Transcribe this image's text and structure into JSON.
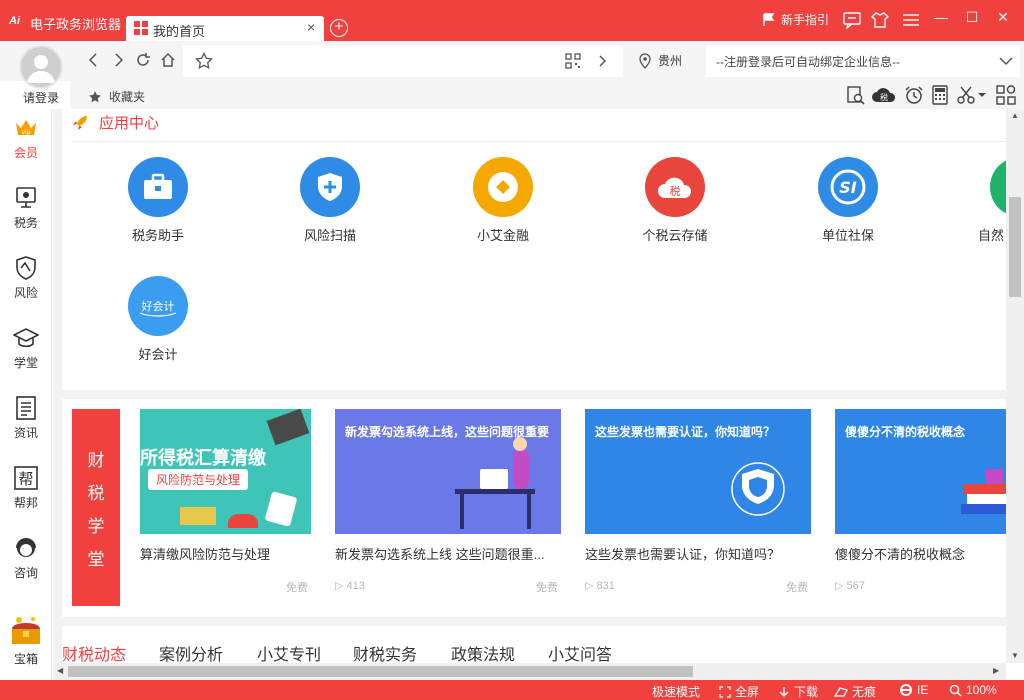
{
  "titlebar": {
    "logo": "Ai",
    "app_name": "电子政务浏览器",
    "tab_label": "我的首页",
    "tab_close": "×",
    "new_tab": "+",
    "guide_label": "新手指引",
    "min": "—",
    "max": "☐",
    "close": "✕"
  },
  "user": {
    "login_label": "请登录"
  },
  "nav": {
    "location": "贵州",
    "bind_text": "--注册登录后可自动绑定企业信息--"
  },
  "bookmarks": {
    "label": "收藏夹"
  },
  "sidebar": {
    "items": [
      {
        "label": "会员",
        "icon": "vip-crown-icon"
      },
      {
        "label": "税务",
        "icon": "tax-icon"
      },
      {
        "label": "风险",
        "icon": "shield-icon"
      },
      {
        "label": "学堂",
        "icon": "graduation-cap-icon"
      },
      {
        "label": "资讯",
        "icon": "news-icon"
      },
      {
        "label": "帮邦",
        "icon": "help-icon"
      },
      {
        "label": "咨询",
        "icon": "headset-icon"
      },
      {
        "label": "宝箱",
        "icon": "treasure-chest-icon"
      }
    ],
    "vip_badge": "vip",
    "help_glyph": "帮"
  },
  "app_center": {
    "title": "应用中心",
    "apps": [
      {
        "name": "税务助手",
        "color": "#2e8be6"
      },
      {
        "name": "风险扫描",
        "color": "#2e8be6"
      },
      {
        "name": "小艾金融",
        "color": "#f5a800"
      },
      {
        "name": "个税云存储",
        "color": "#e8453c"
      },
      {
        "name": "单位社保",
        "color": "#2e8be6"
      },
      {
        "name": "自然",
        "color": "#1fb36a"
      },
      {
        "name": "好会计",
        "color": "#3a9df0"
      }
    ],
    "cloud_glyph": "税",
    "si_glyph": "SI",
    "hkj_glyph": "好会计"
  },
  "school": {
    "tag": [
      "财",
      "税",
      "学",
      "堂"
    ],
    "cards": [
      {
        "thumb_caption": "所得税汇算清缴",
        "thumb_sub": "风险防范与处理",
        "title": "算清缴风险防范与处理",
        "views": "",
        "free": "免费"
      },
      {
        "thumb_caption": "新发票勾选系统上线，这些问题很重要",
        "title": "新发票勾选系统上线 这些问题很重...",
        "views": "413",
        "free": "免费"
      },
      {
        "thumb_caption": "这些发票也需要认证，你知道吗？",
        "title": "这些发票也需要认证，你知道吗？",
        "views": "831",
        "free": "免费"
      },
      {
        "thumb_caption": "傻傻分不清的税收概念",
        "title": "傻傻分不清的税收概念",
        "views": "567",
        "free": ""
      }
    ]
  },
  "news_tabs": [
    "财税动态",
    "案例分析",
    "小艾专刊",
    "财税实务",
    "政策法规",
    "小艾问答"
  ],
  "statusbar": {
    "mode": "极速模式",
    "fullscreen": "全屏",
    "download": "下载",
    "incognito": "无痕",
    "engine": "IE",
    "zoom": "100%"
  },
  "colors": {
    "brand": "#f0413f"
  }
}
